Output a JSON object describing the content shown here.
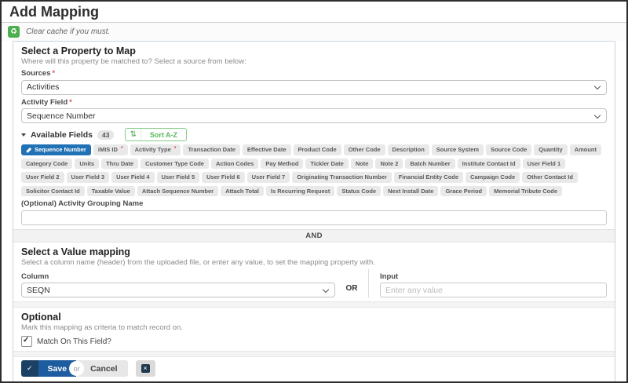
{
  "page": {
    "title": "Add Mapping"
  },
  "required_mark": "*",
  "alert": {
    "text": "Clear cache if you must."
  },
  "property_section": {
    "heading": "Select a Property to Map",
    "subheading": "Where will this property be matched to? Select a source from below:",
    "sources_label": "Sources",
    "sources_value": "Activities",
    "activity_field_label": "Activity Field",
    "activity_field_value": "Sequence Number",
    "available_fields_label": "Available Fields",
    "available_fields_count": "43",
    "sort_button_label": "Sort A-Z",
    "fields": [
      {
        "label": "Sequence Number",
        "selected": true
      },
      {
        "label": "iMIS ID",
        "required": true
      },
      {
        "label": "Activity Type",
        "required": true
      },
      {
        "label": "Transaction Date"
      },
      {
        "label": "Effective Date"
      },
      {
        "label": "Product Code"
      },
      {
        "label": "Other Code"
      },
      {
        "label": "Description"
      },
      {
        "label": "Source System"
      },
      {
        "label": "Source Code"
      },
      {
        "label": "Quantity"
      },
      {
        "label": "Amount"
      },
      {
        "label": "Category Code"
      },
      {
        "label": "Units"
      },
      {
        "label": "Thru Date"
      },
      {
        "label": "Customer Type Code"
      },
      {
        "label": "Action Codes"
      },
      {
        "label": "Pay Method"
      },
      {
        "label": "Tickler Date"
      },
      {
        "label": "Note"
      },
      {
        "label": "Note 2"
      },
      {
        "label": "Batch Number"
      },
      {
        "label": "Institute Contact Id"
      },
      {
        "label": "User Field 1"
      },
      {
        "label": "User Field 2"
      },
      {
        "label": "User Field 3"
      },
      {
        "label": "User Field 4"
      },
      {
        "label": "User Field 5"
      },
      {
        "label": "User Field 6"
      },
      {
        "label": "User Field 7"
      },
      {
        "label": "Originating Transaction Number"
      },
      {
        "label": "Financial Entity Code"
      },
      {
        "label": "Campaign Code"
      },
      {
        "label": "Other Contact Id"
      },
      {
        "label": "Solicitor Contact Id"
      },
      {
        "label": "Taxable Value"
      },
      {
        "label": "Attach Sequence Number"
      },
      {
        "label": "Attach Total"
      },
      {
        "label": "Is Recurring Request"
      },
      {
        "label": "Status Code"
      },
      {
        "label": "Next Install Date"
      },
      {
        "label": "Grace Period"
      },
      {
        "label": "Memorial Tribute Code"
      }
    ],
    "grouping_label": "(Optional) Activity Grouping Name",
    "grouping_value": ""
  },
  "and_divider_label": "AND",
  "value_section": {
    "heading": "Select a Value mapping",
    "subheading": "Select a column name (header) from the uploaded file, or enter any value, to set the mapping property with.",
    "column_label": "Column",
    "column_value": "SEQN",
    "or_label": "OR",
    "input_label": "Input",
    "input_placeholder": "Enter any value",
    "input_value": ""
  },
  "optional_section": {
    "heading": "Optional",
    "subheading": "Mark this mapping as criteria to match record on.",
    "checkbox_label": "Match On This Field?",
    "checkbox_checked": true
  },
  "actions": {
    "save_label": "Save",
    "or_label": "or",
    "cancel_label": "Cancel"
  },
  "colors": {
    "accent_green": "#4cae4f",
    "selected_chip_blue": "#2171b5",
    "save_blue": "#1d5c9e",
    "save_dark_blue": "#1a4164",
    "required_red": "#d9534f"
  }
}
